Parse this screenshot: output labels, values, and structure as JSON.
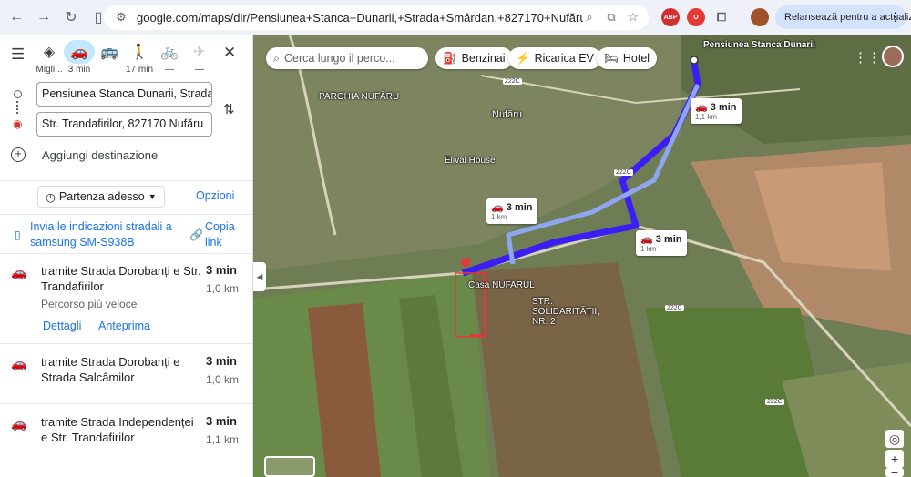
{
  "browser": {
    "url": "google.com/maps/dir/Pensiunea+Stanca+Dunarii,+Strada+Smârdan,+827170+Nufăru/Str.+Trandafirilor",
    "update_button": "Relansează pentru a actualiza",
    "ext_abp": "ABP"
  },
  "modes": [
    {
      "name": "best",
      "label": "Migli..."
    },
    {
      "name": "car",
      "label": "3 min"
    },
    {
      "name": "transit",
      "label": ""
    },
    {
      "name": "walk",
      "label": "17 min"
    },
    {
      "name": "bike",
      "label": "—"
    },
    {
      "name": "flight",
      "label": "—"
    }
  ],
  "directions": {
    "origin": "Pensiunea Stanca Dunarii, Strada",
    "destination": "Str. Trandafirilor, 827170 Nufăru",
    "add_destination": "Aggiungi destinazione",
    "depart": "Partenza adesso",
    "options": "Opzioni",
    "send_to_phone": "Invia le indicazioni stradali a samsung SM-S938B",
    "copy_link": "Copia link"
  },
  "routes": [
    {
      "name": "tramite Strada Dorobanți e Str. Trandafirilor",
      "time": "3 min",
      "distance": "1,0 km",
      "note": "Percorso più veloce",
      "details": "Dettagli",
      "preview": "Anteprima"
    },
    {
      "name": "tramite Strada Dorobanți e Strada Salcâmilor",
      "time": "3 min",
      "distance": "1,0 km"
    },
    {
      "name": "tramite Strada Independenței e Str. Trandafirilor",
      "time": "3 min",
      "distance": "1,1 km"
    }
  ],
  "map": {
    "search_placeholder": "Cerca lungo il perco...",
    "chips": [
      "Benzinai",
      "Ricarica EV",
      "Hotel"
    ],
    "labels": {
      "pensiunea": "Pensiunea Stanca Dunarii",
      "parohia": "PAROHIA NUFĂRU",
      "nufaru": "Nufăru",
      "elival": "Elival House",
      "casa": "Casa NUFARUL",
      "solidaritatii": "STR. SOLIDARITĂȚII, NR. 2"
    },
    "road_badge": "222C",
    "eta": [
      {
        "time": "3 min",
        "dist": "1,1 km"
      },
      {
        "time": "3 min",
        "dist": "1 km"
      },
      {
        "time": "3 min",
        "dist": "1 km"
      }
    ]
  }
}
